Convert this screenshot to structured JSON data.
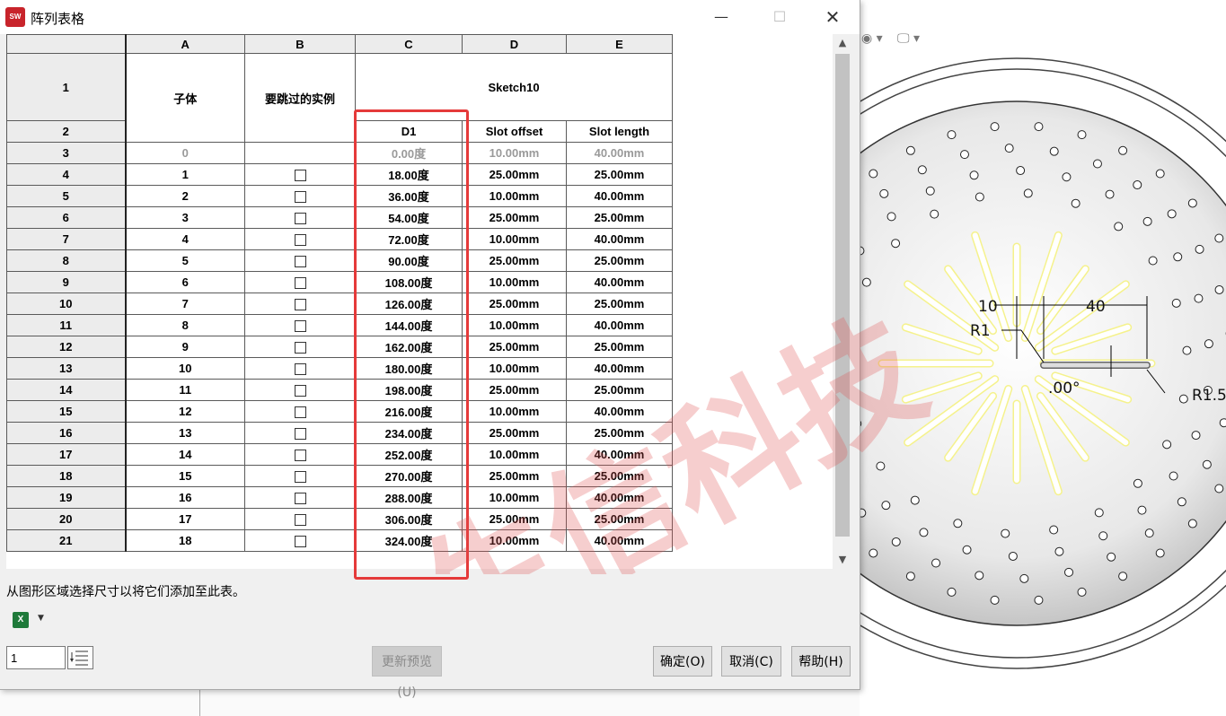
{
  "window": {
    "title": "阵列表格",
    "app_logo": "SW"
  },
  "grid": {
    "col_letters": [
      "A",
      "B",
      "C",
      "D",
      "E"
    ],
    "headers": {
      "child_body": "子体",
      "skip_instances": "要跳过的实例",
      "sketch": "Sketch10",
      "d1": "D1",
      "slot_offset": "Slot offset",
      "slot_length": "Slot length"
    },
    "rows": [
      {
        "num": "3",
        "a": "0",
        "angle": "0.00度",
        "offset": "10.00mm",
        "length": "40.00mm"
      },
      {
        "num": "4",
        "a": "1",
        "angle": "18.00度",
        "offset": "25.00mm",
        "length": "25.00mm"
      },
      {
        "num": "5",
        "a": "2",
        "angle": "36.00度",
        "offset": "10.00mm",
        "length": "40.00mm"
      },
      {
        "num": "6",
        "a": "3",
        "angle": "54.00度",
        "offset": "25.00mm",
        "length": "25.00mm"
      },
      {
        "num": "7",
        "a": "4",
        "angle": "72.00度",
        "offset": "10.00mm",
        "length": "40.00mm"
      },
      {
        "num": "8",
        "a": "5",
        "angle": "90.00度",
        "offset": "25.00mm",
        "length": "25.00mm"
      },
      {
        "num": "9",
        "a": "6",
        "angle": "108.00度",
        "offset": "10.00mm",
        "length": "40.00mm"
      },
      {
        "num": "10",
        "a": "7",
        "angle": "126.00度",
        "offset": "25.00mm",
        "length": "25.00mm"
      },
      {
        "num": "11",
        "a": "8",
        "angle": "144.00度",
        "offset": "10.00mm",
        "length": "40.00mm"
      },
      {
        "num": "12",
        "a": "9",
        "angle": "162.00度",
        "offset": "25.00mm",
        "length": "25.00mm"
      },
      {
        "num": "13",
        "a": "10",
        "angle": "180.00度",
        "offset": "10.00mm",
        "length": "40.00mm"
      },
      {
        "num": "14",
        "a": "11",
        "angle": "198.00度",
        "offset": "25.00mm",
        "length": "25.00mm"
      },
      {
        "num": "15",
        "a": "12",
        "angle": "216.00度",
        "offset": "10.00mm",
        "length": "40.00mm"
      },
      {
        "num": "16",
        "a": "13",
        "angle": "234.00度",
        "offset": "25.00mm",
        "length": "25.00mm"
      },
      {
        "num": "17",
        "a": "14",
        "angle": "252.00度",
        "offset": "10.00mm",
        "length": "40.00mm"
      },
      {
        "num": "18",
        "a": "15",
        "angle": "270.00度",
        "offset": "25.00mm",
        "length": "25.00mm"
      },
      {
        "num": "19",
        "a": "16",
        "angle": "288.00度",
        "offset": "10.00mm",
        "length": "40.00mm"
      },
      {
        "num": "20",
        "a": "17",
        "angle": "306.00度",
        "offset": "25.00mm",
        "length": "25.00mm"
      },
      {
        "num": "21",
        "a": "18",
        "angle": "324.00度",
        "offset": "10.00mm",
        "length": "40.00mm"
      }
    ]
  },
  "hint": "从图形区域选择尺寸以将它们添加至此表。",
  "instance_input": {
    "value": "1"
  },
  "buttons": {
    "preview": "更新预览(U)",
    "ok": "确定(O)",
    "cancel": "取消(C)",
    "help": "帮助(H)"
  },
  "cad": {
    "dim_10": "10",
    "dim_40": "40",
    "dim_r1": "R1",
    "dim_angle": ".00°",
    "dim_r15": "R1.5"
  },
  "watermark": "生信科技",
  "colors": {
    "highlight_box": "#e53a3a",
    "slot_yellow": "#f5f28c"
  }
}
